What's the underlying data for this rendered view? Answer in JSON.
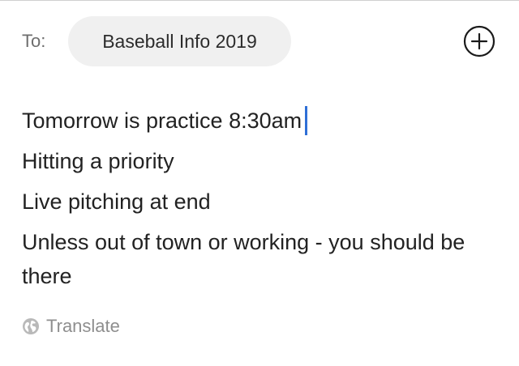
{
  "header": {
    "to_label": "To:",
    "recipient": "Baseball Info 2019",
    "add_icon": "plus-circle-icon"
  },
  "message": {
    "lines": [
      "Tomorrow is practice 8:30am",
      "Hitting a priority",
      "Live pitching at end",
      "Unless out of town or working - you should be there"
    ]
  },
  "footer": {
    "translate_label": "Translate",
    "translate_icon": "globe-icon"
  },
  "colors": {
    "caret": "#2f6fd6",
    "chip_bg": "#f0f0f0"
  }
}
